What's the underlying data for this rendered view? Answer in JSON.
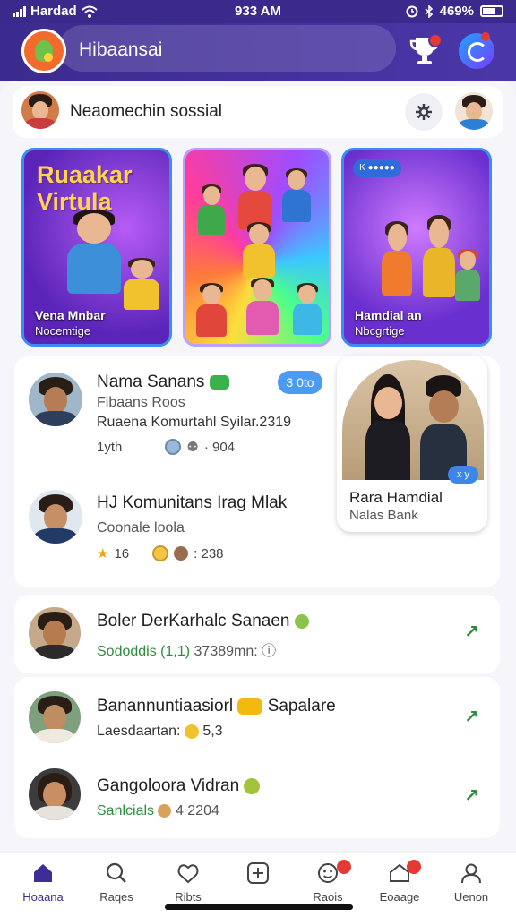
{
  "status_bar": {
    "carrier": "Hardad",
    "time": "933 AM",
    "battery": "469%"
  },
  "app": {
    "title": "Hibaansai"
  },
  "composer": {
    "text": "Neaomechin sossial"
  },
  "feature_cards": [
    {
      "headline_1": "Ruaakar",
      "headline_2": "Virtula",
      "caption_1": "Vena Mnbar",
      "caption_2": "Nocemtige"
    },
    {
      "caption_1": "",
      "caption_2": ""
    },
    {
      "chip": "K ●●●●●",
      "caption_1": "Hamdial an",
      "caption_2": "Nbcgrtige"
    }
  ],
  "people": [
    {
      "name": "Nama Sanans",
      "line_1": "Fibaans Roos",
      "line_2": "Ruaena Komurtahl Syilar.2319",
      "meta_left": "1yth",
      "meta_right": "· 904",
      "pill": "3 0to"
    },
    {
      "name": "HJ Komunitans Irag Mlak",
      "line_1": "Coonale loola",
      "meta_left": "16",
      "meta_right": ": 238"
    }
  ],
  "featured_couple": {
    "name": "Rara Hamdial",
    "subtitle": "Nalas Bank",
    "badge": "x y"
  },
  "list": [
    {
      "name": "Boler DerKarhalc Sanaen",
      "detail": "Sododdis (1,1)",
      "extra": "37389mn: ⓘ"
    },
    {
      "name": "Banannuntiaasiorl",
      "name_suffix": "Sapalare",
      "detail": "Laesdaartan:",
      "extra": "5,3"
    },
    {
      "name": "Gangoloora Vidran",
      "detail": "Sanlcials",
      "extra": "4 2204"
    }
  ],
  "nav": [
    "Hoaana",
    "Raqes",
    "Ribts",
    "",
    "Raois",
    "Eoaage",
    "Uenon"
  ],
  "colors": {
    "header": "#3c2b8e",
    "accent": "#3b8ef0",
    "badge": "#e53935",
    "green": "#2e8b3c"
  }
}
